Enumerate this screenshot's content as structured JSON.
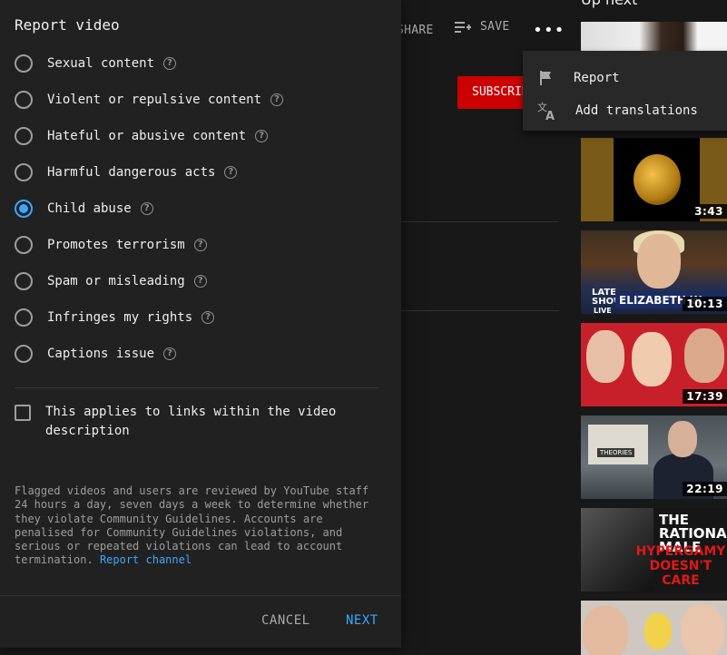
{
  "background": {
    "actions": {
      "share": "SHARE",
      "save": "SAVE"
    },
    "subscribe_label": "SUBSCRIBE",
    "up_next": "Up next",
    "thumbnails": [
      {
        "duration": "3:43"
      },
      {
        "duration": "10:13",
        "banner": "ELIZABETH W",
        "show_logo": "LATE\nSHOW",
        "live": "LIVE"
      },
      {
        "duration": "17:39"
      },
      {
        "duration": "22:19",
        "sign": "THEORIES"
      },
      {
        "title1": "THE RATIONAL MALE",
        "title2": "HYPERGAMY DOESN'T CARE"
      }
    ]
  },
  "menu": {
    "items": [
      {
        "label": "Report",
        "icon": "flag-icon"
      },
      {
        "label": "Add translations",
        "icon": "translate-icon"
      }
    ]
  },
  "dialog": {
    "title": "Report video",
    "options": [
      {
        "label": "Sexual content",
        "checked": false
      },
      {
        "label": "Violent or repulsive content",
        "checked": false
      },
      {
        "label": "Hateful or abusive content",
        "checked": false
      },
      {
        "label": "Harmful dangerous acts",
        "checked": false
      },
      {
        "label": "Child abuse",
        "checked": true
      },
      {
        "label": "Promotes terrorism",
        "checked": false
      },
      {
        "label": "Spam or misleading",
        "checked": false
      },
      {
        "label": "Infringes my rights",
        "checked": false
      },
      {
        "label": "Captions issue",
        "checked": false
      }
    ],
    "checkbox_label": "This applies to links within the video description",
    "fine_print": "Flagged videos and users are reviewed by YouTube staff 24 hours a day, seven days a week to determine whether they violate Community Guidelines. Accounts are penalised for Community Guidelines violations, and serious or repeated violations can lead to account termination.",
    "report_channel": "Report channel",
    "cancel": "CANCEL",
    "next": "NEXT"
  },
  "colors": {
    "accent": "#3ea6ff",
    "subscribe": "#cc0000",
    "dialog_bg": "#212121"
  }
}
